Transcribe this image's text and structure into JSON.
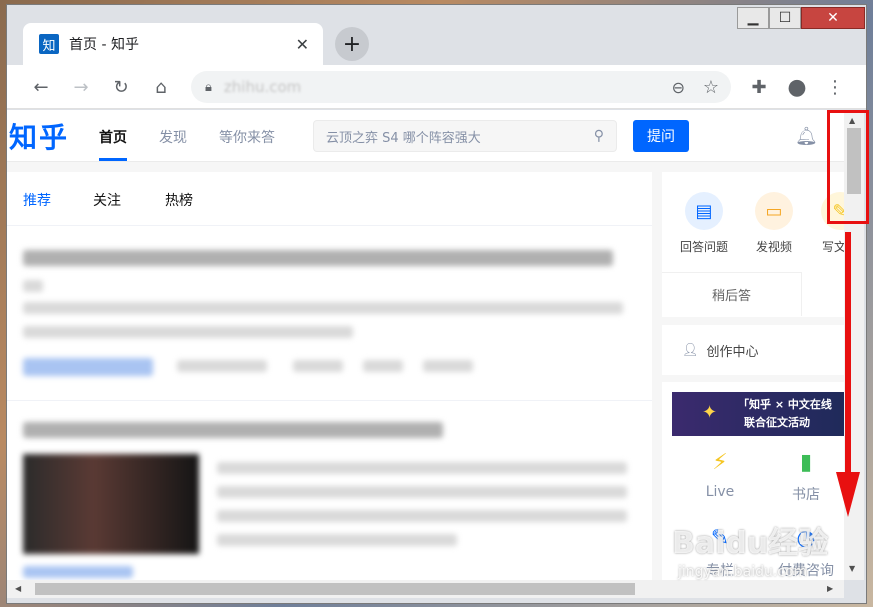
{
  "browser": {
    "tab_title": "首页 - 知乎",
    "favicon_text": "知",
    "tab_close": "✕",
    "new_tab": "+",
    "url": "zhihu.com",
    "window_controls": {
      "minimize": "▁",
      "maximize": "☐",
      "close": "✕"
    }
  },
  "header": {
    "logo": "知乎",
    "nav": [
      "首页",
      "发现",
      "等你来答"
    ],
    "search_placeholder": "云顶之弈 S4 哪个阵容强大",
    "ask_button": "提问"
  },
  "feed": {
    "tabs": [
      "推荐",
      "关注",
      "热榜"
    ]
  },
  "sidebar": {
    "shortcuts": [
      {
        "label": "回答问题",
        "icon": "answer-icon",
        "color": "#0066ff"
      },
      {
        "label": "发视频",
        "icon": "video-icon",
        "color": "#f5a623"
      },
      {
        "label": "写文章",
        "icon": "write-icon",
        "color": "#f5c623"
      }
    ],
    "answer_later": "稍后答",
    "creator_center": "创作中心",
    "banner": {
      "line1": "「知乎 × 中文在线",
      "line2": "联合征文活动"
    },
    "grid": [
      {
        "label": "Live",
        "icon": "lightning-icon",
        "color": "#f5c623"
      },
      {
        "label": "书店",
        "icon": "book-icon",
        "color": "#3dbd57"
      },
      {
        "label": "专栏",
        "icon": "pen-icon",
        "color": "#0066ff"
      },
      {
        "label": "付费咨询",
        "icon": "consult-icon",
        "color": "#0066ff"
      }
    ]
  },
  "watermark": {
    "main": "Baidu经验",
    "sub": "jingyan.baidu.com"
  }
}
